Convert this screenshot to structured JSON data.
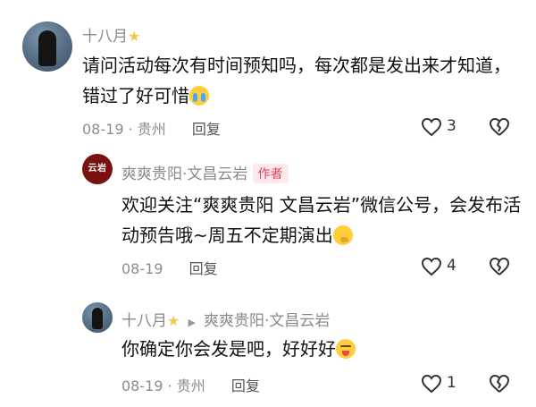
{
  "comments": [
    {
      "user": "十八月",
      "text": "请问活动每次有时间预知吗，每次都是发出来才知道，错过了好可惜",
      "date": "08-19",
      "location": "贵州",
      "reply_label": "回复",
      "likes": "3"
    }
  ],
  "replies": [
    {
      "user": "爽爽贵阳·文昌云岩",
      "badge": "作者",
      "avatar_text": "云岩",
      "text": "欢迎关注“爽爽贵阳 文昌云岩”微信公号，会发布活动预告哦~周五不定期演出",
      "date": "08-19",
      "reply_label": "回复",
      "likes": "4"
    },
    {
      "user": "十八月",
      "reply_to": "爽爽贵阳·文昌云岩",
      "text": "你确定你会发是吧，好好好",
      "date": "08-19",
      "location": "贵州",
      "reply_label": "回复",
      "likes": "1"
    }
  ],
  "separator": "·",
  "icons": {
    "star": "star-icon",
    "like": "heart-outline-icon",
    "dislike": "broken-heart-icon",
    "reply_arrow": "play-triangle-icon",
    "emoji_cry": "crying-face-emoji",
    "emoji_think": "thinking-face-emoji",
    "emoji_wink": "winking-tongue-face-emoji"
  },
  "colors": {
    "badge_bg": "#fde8ec",
    "badge_text": "#e1415b",
    "star": "#f5c84a",
    "meta": "#8c8c8c"
  }
}
